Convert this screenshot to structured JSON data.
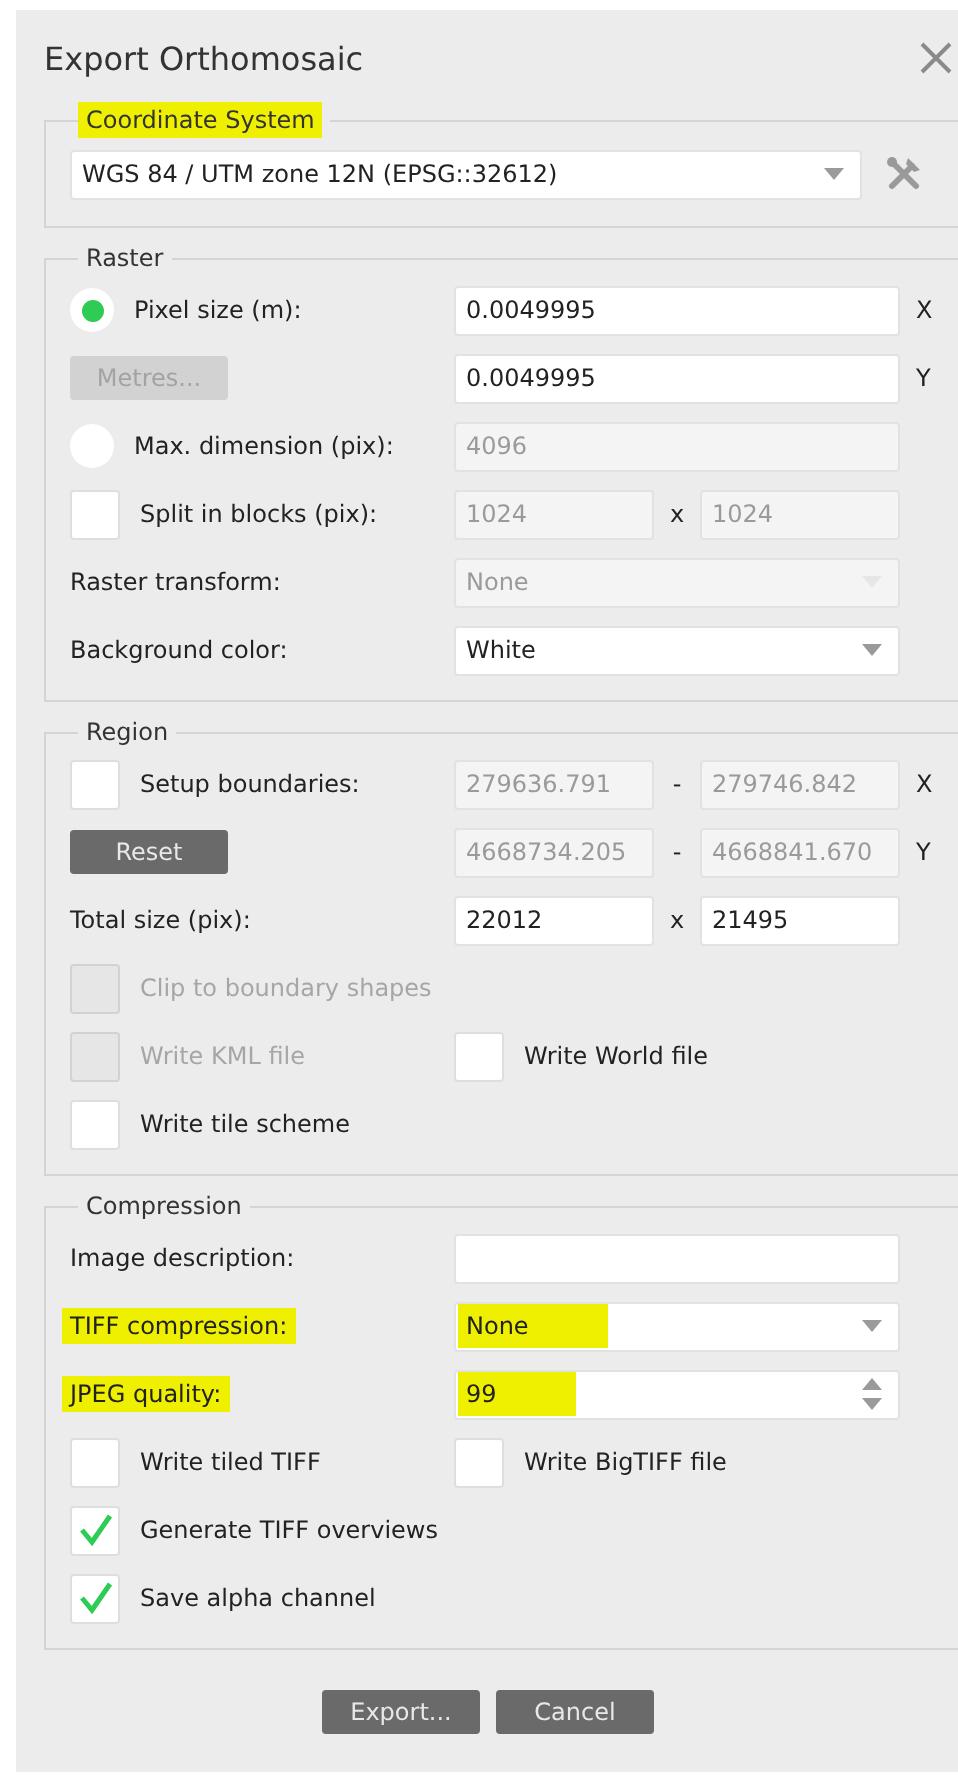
{
  "window": {
    "title": "Export Orthomosaic"
  },
  "coordinate_system": {
    "legend": "Coordinate System",
    "highlighted": true,
    "value": "WGS 84 / UTM zone 12N (EPSG::32612)"
  },
  "groups": [
    {
      "legend": "Raster",
      "rows": [
        {
          "kind": "radio",
          "label": "Pixel size (m):",
          "selected": true,
          "fields": [
            {
              "kind": "text",
              "value": "0.0049995",
              "disabled": false
            }
          ],
          "suffix": "X"
        },
        {
          "kind": "button",
          "label": "Metres...",
          "disabled": true,
          "fields": [
            {
              "kind": "text",
              "value": "0.0049995",
              "disabled": false
            }
          ],
          "suffix": "Y"
        },
        {
          "kind": "radio",
          "label": "Max. dimension (pix):",
          "selected": false,
          "fields": [
            {
              "kind": "text",
              "value": "4096",
              "disabled": true
            }
          ]
        },
        {
          "kind": "checkbox",
          "label": "Split in blocks (pix):",
          "checked": false,
          "fields": [
            {
              "kind": "text",
              "value": "1024",
              "disabled": true
            },
            {
              "kind": "text",
              "value": "1024",
              "disabled": true
            }
          ],
          "separator": "x"
        },
        {
          "kind": "label",
          "label": "Raster transform:",
          "fields": [
            {
              "kind": "select",
              "value": "None",
              "disabled": true
            }
          ]
        },
        {
          "kind": "label",
          "label": "Background color:",
          "fields": [
            {
              "kind": "select",
              "value": "White",
              "disabled": false
            }
          ]
        }
      ]
    },
    {
      "legend": "Region",
      "rows": [
        {
          "kind": "checkbox",
          "label": "Setup boundaries:",
          "checked": false,
          "fields": [
            {
              "kind": "text",
              "value": "279636.791",
              "disabled": true
            },
            {
              "kind": "text",
              "value": "279746.842",
              "disabled": true
            }
          ],
          "separator": "-",
          "suffix": "X"
        },
        {
          "kind": "button",
          "label": "Reset",
          "disabled": false,
          "fields": [
            {
              "kind": "text",
              "value": "4668734.205",
              "disabled": true
            },
            {
              "kind": "text",
              "value": "4668841.670",
              "disabled": true
            }
          ],
          "separator": "-",
          "suffix": "Y"
        },
        {
          "kind": "label",
          "label": "Total size (pix):",
          "fields": [
            {
              "kind": "text",
              "value": "22012",
              "disabled": false
            },
            {
              "kind": "text",
              "value": "21495",
              "disabled": false
            }
          ],
          "separator": "x"
        },
        {
          "kind": "checks",
          "items": [
            {
              "label": "Clip to boundary shapes",
              "checked": false,
              "disabled": true
            }
          ]
        },
        {
          "kind": "checks",
          "items": [
            {
              "label": "Write KML file",
              "checked": false,
              "disabled": true
            },
            {
              "label": "Write World file",
              "checked": false,
              "disabled": false
            }
          ]
        },
        {
          "kind": "checks",
          "items": [
            {
              "label": "Write tile scheme",
              "checked": false,
              "disabled": false
            }
          ]
        }
      ]
    },
    {
      "legend": "Compression",
      "rows": [
        {
          "kind": "label",
          "label": "Image description:",
          "fields": [
            {
              "kind": "text"
            }
          ]
        },
        {
          "kind": "label",
          "label": "TIFF compression:",
          "highlighted": true,
          "fields": [
            {
              "kind": "select",
              "value": "None",
              "disabled": false,
              "highlighted": true
            }
          ]
        },
        {
          "kind": "label",
          "label": "JPEG quality:",
          "highlighted": true,
          "fields": [
            {
              "kind": "spin",
              "value": "99",
              "disabled": false,
              "highlighted": true
            }
          ]
        },
        {
          "kind": "checks",
          "items": [
            {
              "label": "Write tiled TIFF",
              "checked": false,
              "disabled": false
            },
            {
              "label": "Write BigTIFF file",
              "checked": false,
              "disabled": false
            }
          ]
        },
        {
          "kind": "checks",
          "items": [
            {
              "label": "Generate TIFF overviews",
              "checked": true,
              "disabled": false
            }
          ]
        },
        {
          "kind": "checks",
          "items": [
            {
              "label": "Save alpha channel",
              "checked": true,
              "disabled": false
            }
          ]
        }
      ]
    }
  ],
  "buttons": [
    "Export...",
    "Cancel"
  ]
}
